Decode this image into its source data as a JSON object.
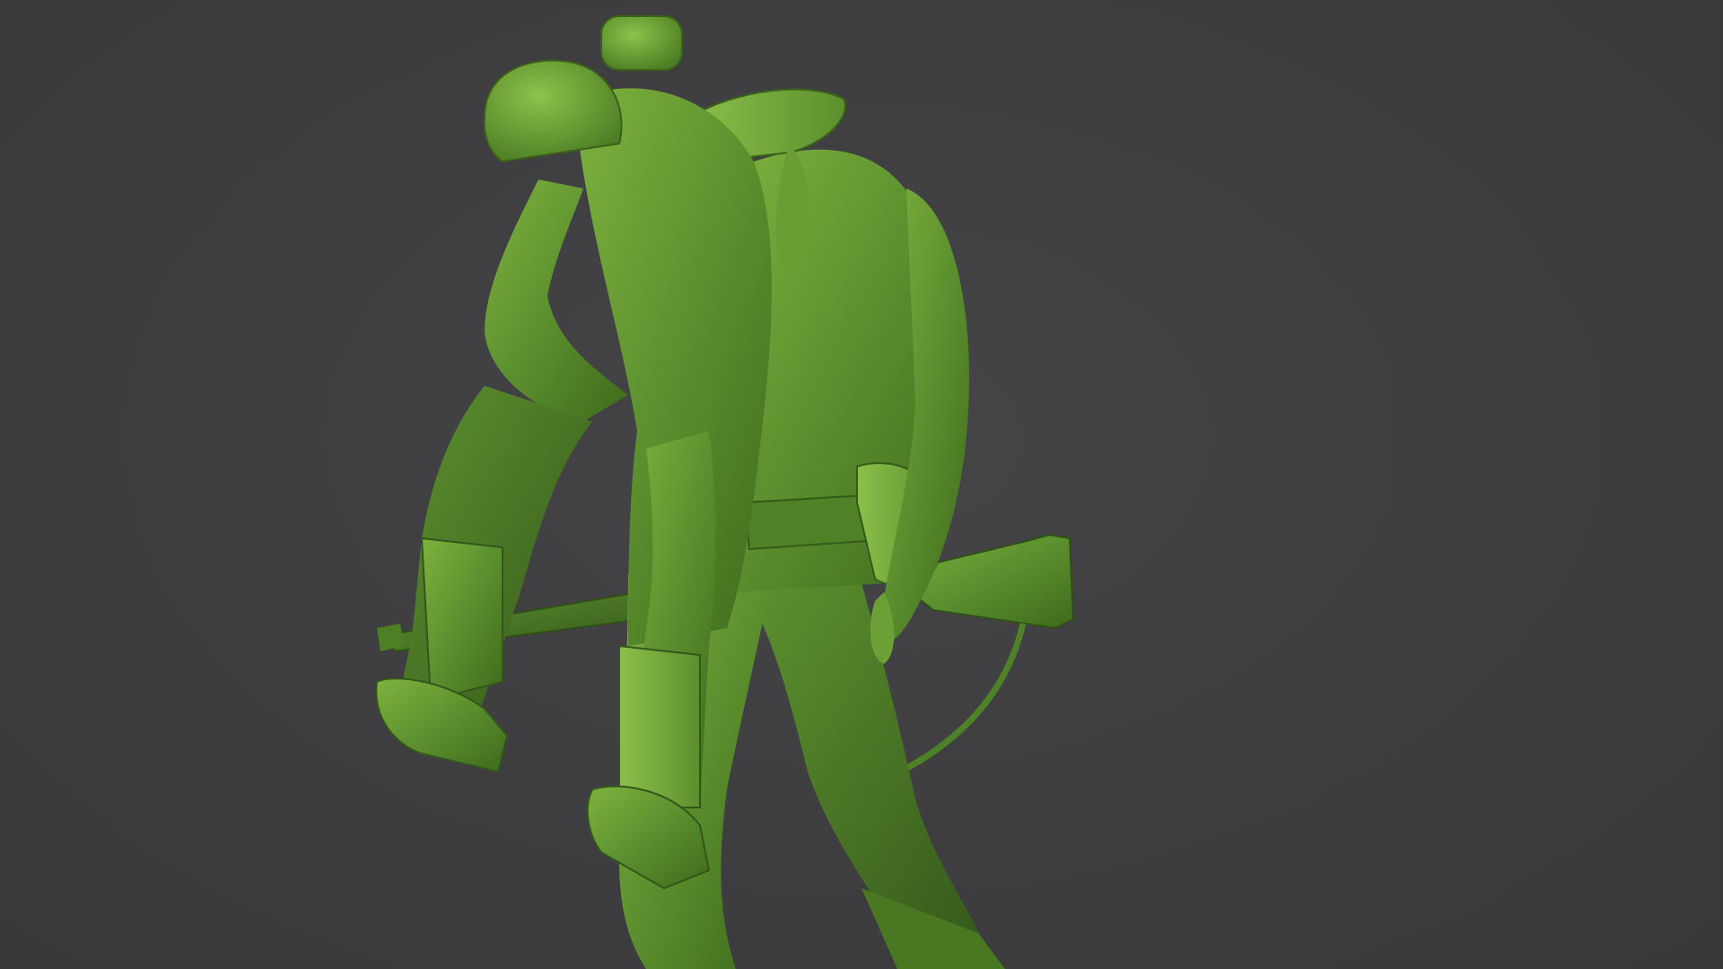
{
  "viewport": {
    "background_color": "#3e3e40",
    "model_color": "#5b8a2c",
    "subject": "green-plastic-soldier-figure"
  }
}
